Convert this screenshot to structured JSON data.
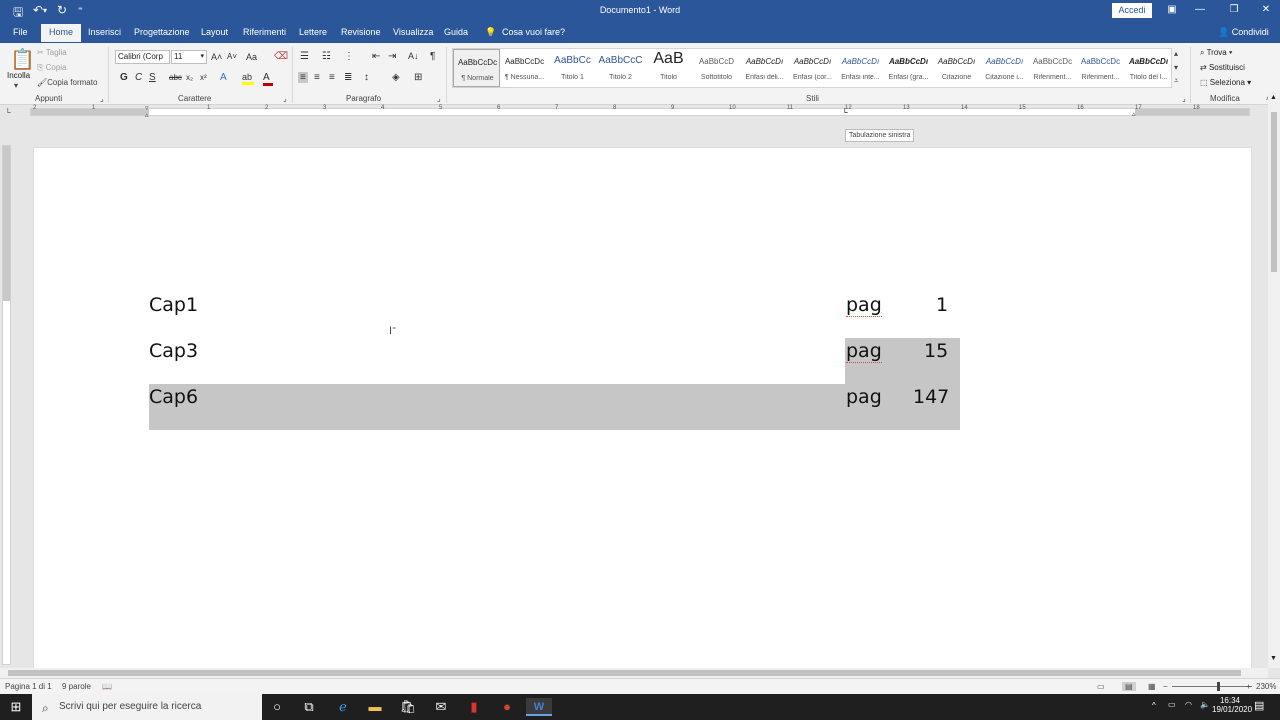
{
  "titlebar": {
    "title": "Documento1 - Word",
    "accedi": "Accedi",
    "save_icon": "save-icon",
    "undo_icon": "undo-icon",
    "redo_icon": "redo-icon"
  },
  "tabs": [
    {
      "label": "File"
    },
    {
      "label": "Home"
    },
    {
      "label": "Inserisci"
    },
    {
      "label": "Progettazione"
    },
    {
      "label": "Layout"
    },
    {
      "label": "Riferimenti"
    },
    {
      "label": "Lettere"
    },
    {
      "label": "Revisione"
    },
    {
      "label": "Visualizza"
    },
    {
      "label": "Guida"
    }
  ],
  "tell_me": "Cosa vuoi fare?",
  "condividi": "Condividi",
  "clipboard": {
    "paste": "Incolla",
    "cut": "Taglia",
    "copy": "Copia",
    "format_painter": "Copia formato",
    "group": "Appunti"
  },
  "font": {
    "name": "Calibri (Corp",
    "size": "11",
    "group": "Carattere",
    "bold": "G",
    "italic": "C",
    "underline": "S",
    "strike": "abc",
    "subscript": "x₂",
    "superscript": "x²",
    "grow": "A˄",
    "shrink": "A˅",
    "case": "Aa",
    "text_effects": "A",
    "highlight": "ab",
    "font_color": "A",
    "highlight_color": "#ffff00",
    "font_color_value": "#c00000"
  },
  "paragraph": {
    "group": "Paragrafo",
    "pilcrow": "¶",
    "sort": "A↓"
  },
  "styles": {
    "group": "Stili",
    "items": [
      {
        "preview": "AaBbCcDc",
        "name": "¶ Normale"
      },
      {
        "preview": "AaBbCcDc",
        "name": "¶ Nessuna..."
      },
      {
        "preview": "AaBbCc",
        "name": "Titolo 1"
      },
      {
        "preview": "AaBbCcC",
        "name": "Titolo 2"
      },
      {
        "preview": "AaB",
        "name": "Titolo"
      },
      {
        "preview": "AaBbCcD",
        "name": "Sottotitolo"
      },
      {
        "preview": "AaBbCcDı",
        "name": "Enfasi deli..."
      },
      {
        "preview": "AaBbCcDı",
        "name": "Enfasi (cor..."
      },
      {
        "preview": "AaBbCcDı",
        "name": "Enfasi inte..."
      },
      {
        "preview": "AaBbCcDı",
        "name": "Enfasi (gra..."
      },
      {
        "preview": "AaBbCcDı",
        "name": "Citazione"
      },
      {
        "preview": "AaBbCcDı",
        "name": "Citazione i..."
      },
      {
        "preview": "AaBbCcDc",
        "name": "Riferiment..."
      },
      {
        "preview": "AaBbCcDc",
        "name": "Riferiment..."
      },
      {
        "preview": "AaBbCcDı",
        "name": "Titolo del l..."
      }
    ]
  },
  "editing": {
    "group": "Modifica",
    "find": "Trova",
    "replace": "Sostituisci",
    "select": "Seleziona"
  },
  "ruler_numbers": [
    "2",
    "1",
    "1",
    "2",
    "3",
    "4",
    "5",
    "6",
    "7",
    "8",
    "9",
    "10",
    "11",
    "12",
    "13",
    "14",
    "15",
    "16",
    "17",
    "18"
  ],
  "tooltip": "Tabulazione sinistra",
  "document": {
    "lines": [
      {
        "chapter": "Cap1",
        "pag": "pag",
        "num": "1"
      },
      {
        "chapter": "Cap3",
        "pag": "pag",
        "num": "15"
      },
      {
        "chapter": "Cap6",
        "pag": "pag",
        "num": "147"
      }
    ],
    "selection_color": "#c6c6c6"
  },
  "statusbar": {
    "page": "Pagina 1 di 1",
    "words": "9 parole",
    "zoom": "230%"
  },
  "taskbar": {
    "search_placeholder": "Scrivi qui per eseguire la ricerca",
    "time": "16:34",
    "date": "19/01/2020"
  },
  "colors": {
    "brand": "#2b579a",
    "taskbar": "#1f1f1f"
  }
}
